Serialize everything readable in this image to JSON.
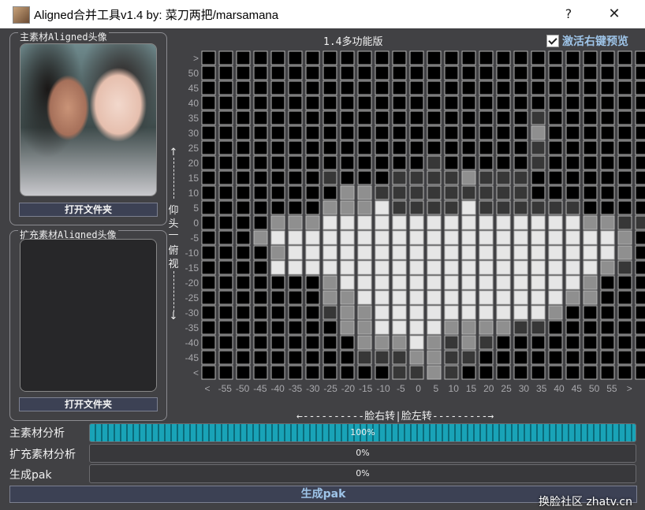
{
  "titlebar": {
    "title": "Aligned合并工具v1.4  by: 菜刀两把/marsamana",
    "help_label": "?",
    "close_label": "✕",
    "icon": "app-icon"
  },
  "main_source": {
    "title": "主素材Aligned头像",
    "open_button": "打开文件夹"
  },
  "extra_source": {
    "title": "扩充素材Aligned头像",
    "open_button": "打开文件夹"
  },
  "chart": {
    "version": "1.4多功能版",
    "checkbox_label": "激活右键预览",
    "checkbox_checked": true,
    "vertical_label": [
      "仰",
      "头",
      "—",
      "俯",
      "视"
    ],
    "horizontal_label": "←----------脸右转|脸左转---------→"
  },
  "progress": [
    {
      "label": "主素材分析",
      "value": 100,
      "text": "100%"
    },
    {
      "label": "扩充素材分析",
      "value": 0,
      "text": "0%"
    },
    {
      "label": "生成pak",
      "value": 0,
      "text": "0%"
    }
  ],
  "generate_button": "生成pak",
  "watermark": "换脸社区 zhatv.cn",
  "chart_data": {
    "type": "heatmap",
    "title": "1.4多功能版",
    "y_labels": [
      ">",
      "50",
      "45",
      "40",
      "35",
      "30",
      "25",
      "20",
      "15",
      "10",
      "5",
      "0",
      "-5",
      "-10",
      "-15",
      "-20",
      "-25",
      "-30",
      "-35",
      "-40",
      "-45",
      "<"
    ],
    "x_labels": [
      "<",
      "-55",
      "-50",
      "-45",
      "-40",
      "-35",
      "-30",
      "-25",
      "-20",
      "-15",
      "-10",
      "-5",
      "0",
      "5",
      "10",
      "15",
      "20",
      "25",
      "30",
      "35",
      "40",
      "45",
      "50",
      "55",
      ">"
    ],
    "level_colors": [
      "#000000",
      "#373737",
      "#8f8f8f",
      "#e6e6e6"
    ],
    "cells": [
      "000000000000000000000000000",
      "000000000000000000000000000",
      "000000000000000000000000000",
      "000000000000000000000000000",
      "000000000000000000010000000",
      "000000000000000000020000000",
      "000000000000000000010000000",
      "000000000000010000010000000",
      "000000010001111211100000000",
      "000000002211111111100000000",
      "000000022231111311111100000",
      "000022233333333333333322110",
      "000233333333333333333333200",
      "000023333333333333333333200",
      "000033333333333333333332100",
      "000000023333333333333320000",
      "000000022333333333333220000",
      "000000012233333333332000000",
      "000000002233332222110000000",
      "000000000222321210000000000",
      "000000000111221100000000000",
      "000000000001121000000000000"
    ]
  }
}
